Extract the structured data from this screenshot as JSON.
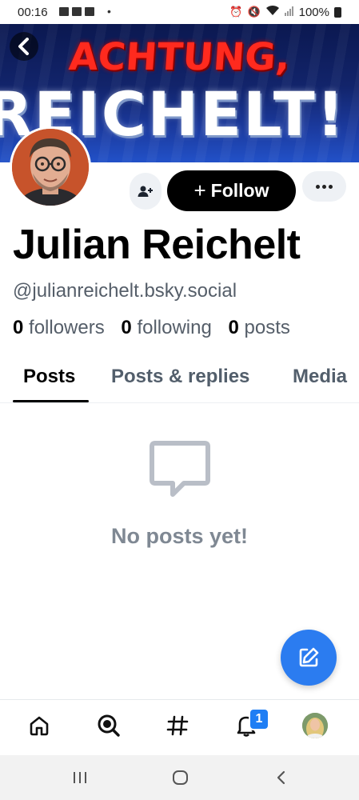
{
  "status_bar": {
    "time": "00:16",
    "battery": "100%",
    "icons": [
      "notification-icon",
      "notification-icon",
      "notification-icon",
      "alarm-icon",
      "mute-icon",
      "wifi-icon",
      "signal-icon",
      "battery-icon"
    ]
  },
  "banner": {
    "line1": "ACHTUNG,",
    "line2": "REICHELT!"
  },
  "profile": {
    "display_name": "Julian Reichelt",
    "handle": "@julianreichelt.bsky.social",
    "followers_count": "0",
    "followers_label": "followers",
    "following_count": "0",
    "following_label": "following",
    "posts_count": "0",
    "posts_label": "posts"
  },
  "actions": {
    "follow_label": "Follow",
    "follow_icon": "+"
  },
  "tabs": [
    {
      "label": "Posts",
      "active": true
    },
    {
      "label": "Posts & replies",
      "active": false
    },
    {
      "label": "Media",
      "active": false
    }
  ],
  "feed": {
    "empty_message": "No posts yet!"
  },
  "bottom_nav": {
    "notifications_badge": "1",
    "items": [
      "home-icon",
      "search-icon",
      "hashtag-icon",
      "notifications-icon",
      "profile-avatar"
    ]
  },
  "colors": {
    "accent": "#2b7cf0",
    "follow_button": "#000000",
    "muted_text": "#555e69"
  }
}
